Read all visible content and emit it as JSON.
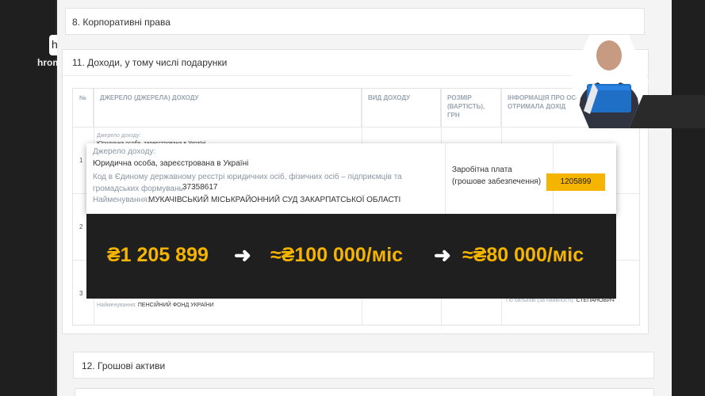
{
  "edge": {
    "letter": "h",
    "site": "hrom"
  },
  "sections": {
    "s8": "8. Корпоративні права",
    "s11": "11. Доходи, у тому числі подарунки",
    "s12": "12. Грошові активи"
  },
  "table": {
    "headers": [
      "№",
      "ДЖЕРЕЛО (ДЖЕРЕЛА) ДОХОДУ",
      "ВИД ДОХОДУ",
      "РОЗМІР (ВАРТІСТЬ), ГРН",
      "ІНФОРМАЦІЯ ПРО ОСОБУ, ЯКА ОТРИМАЛА ДОХІД"
    ],
    "rows": [
      {
        "num": "1",
        "source_label": "Джерело доходу:",
        "source_value": "Юридична особа, зареєстрована в Україні"
      },
      {
        "num": "2"
      },
      {
        "num": "3",
        "name_label": "Найменування:",
        "name_value": "ПЕНСІЙНИЙ ФОНД УКРАЇНИ",
        "patronymic_label": "По батькові (за наявності):",
        "patronymic_value": "СТЕПАНОВИЧ"
      }
    ]
  },
  "popup": {
    "source_label": "Джерело доходу:",
    "source_value": "Юридична особа, зареєстрована в Україні",
    "code_label": "Код в Єдиному державному реєстрі юридичних осіб, фізичних осіб – підприємців та громадських формувань:",
    "code_value": "37358617",
    "name_label": "Найменування:",
    "name_value": "МУКАЧІВСЬКИЙ МІСЬКРАЙОННИЙ СУД ЗАКАРПАТСЬКОЇ ОБЛАСТІ",
    "income_type": "Заробітна плата (грошове забезпечення)",
    "amount": "1205899"
  },
  "banner": {
    "value1": "₴1 205 899",
    "value2": "≈₴100 000/міс",
    "value3": "≈₴80 000/міс",
    "arrow": "➜",
    "accent": "#f5b400"
  }
}
